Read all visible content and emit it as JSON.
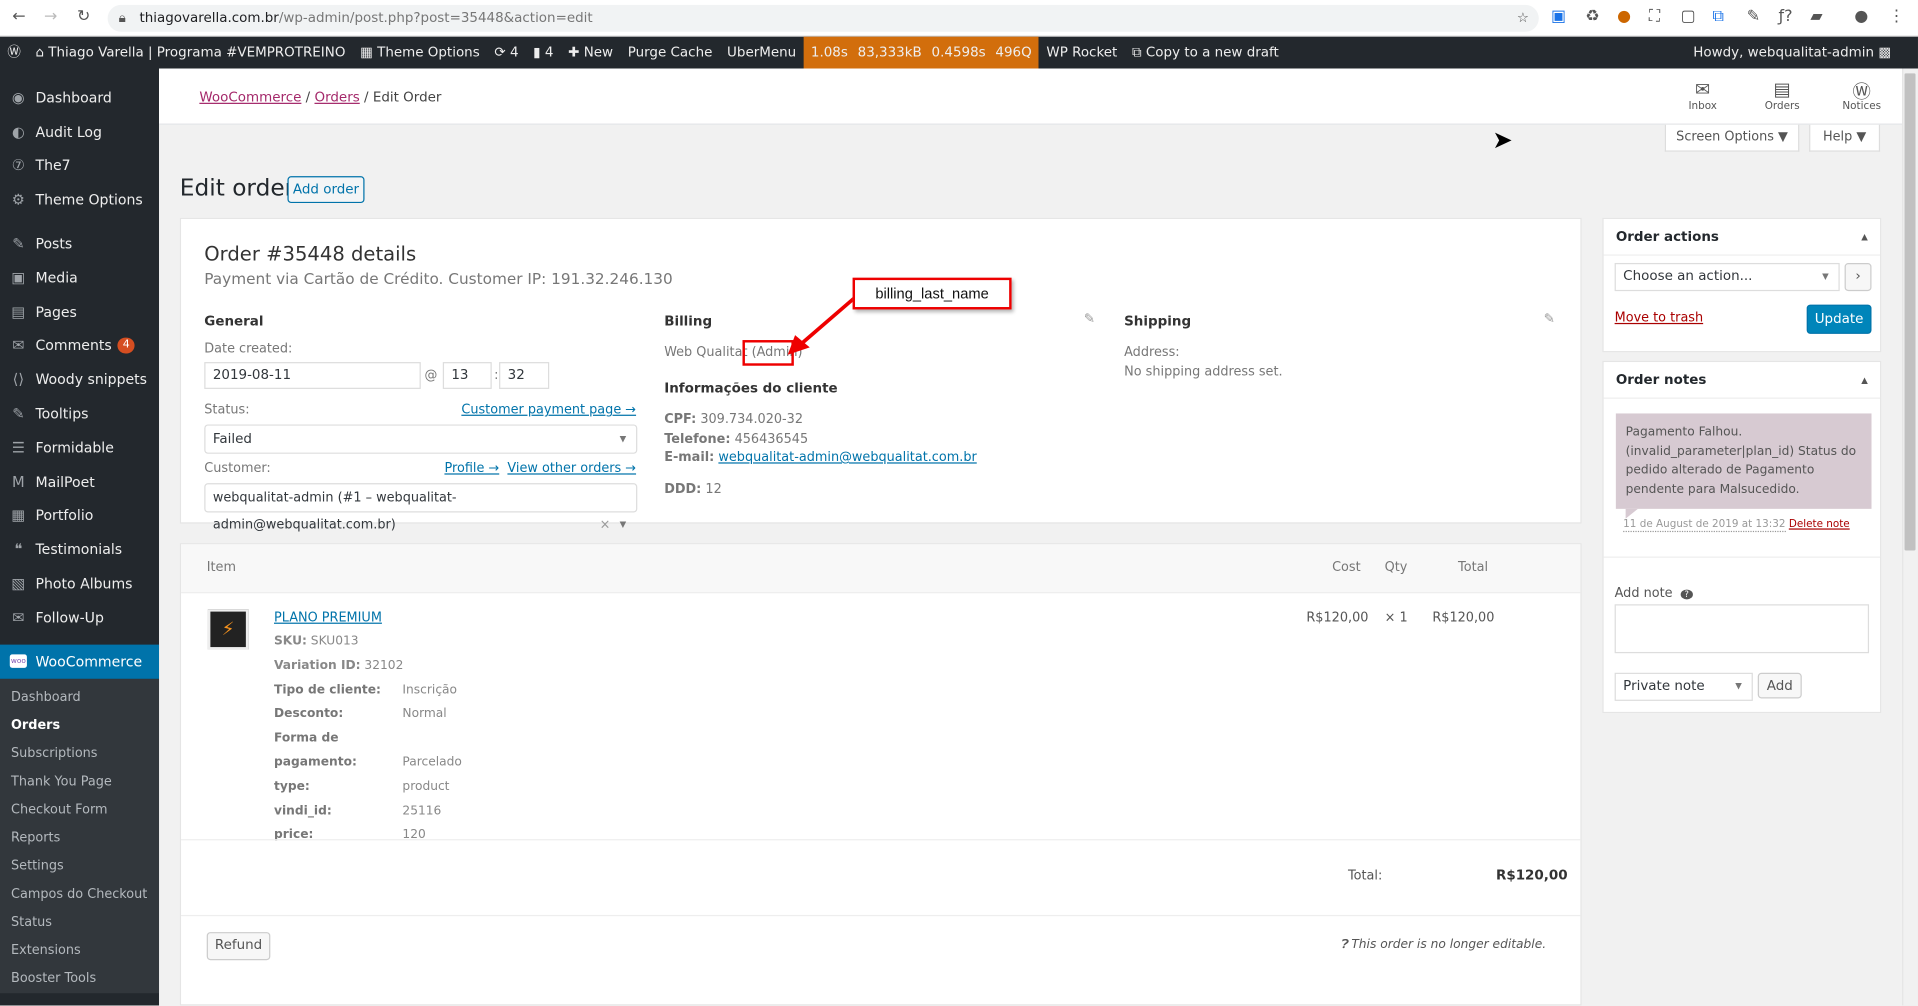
{
  "browser": {
    "url_host": "thiagovarella.com.br",
    "url_path": "/wp-admin/post.php?post=35448&action=edit"
  },
  "adminbar": {
    "site": "Thiago Varella | Programa #VEMPROTREINO",
    "theme_options": "Theme Options",
    "updates": "4",
    "comments": "4",
    "new": "New",
    "purge": "Purge Cache",
    "ubermenu": "UberMenu",
    "perf": [
      "1.08s",
      "83,333kB",
      "0.4598s",
      "496Q"
    ],
    "wprocket": "WP Rocket",
    "copy": "Copy to a new draft",
    "howdy": "Howdy, webqualitat-admin"
  },
  "sidebar": {
    "items": [
      {
        "label": "Dashboard",
        "icon": "◉"
      },
      {
        "label": "Audit Log",
        "icon": "◐"
      },
      {
        "label": "The7",
        "icon": "⑦"
      },
      {
        "label": "Theme Options",
        "icon": "⚙"
      },
      {
        "label": "Posts",
        "icon": "✎"
      },
      {
        "label": "Media",
        "icon": "▣"
      },
      {
        "label": "Pages",
        "icon": "▤"
      },
      {
        "label": "Comments",
        "icon": "✉",
        "badge": "4"
      },
      {
        "label": "Woody snippets",
        "icon": "⟨⟩"
      },
      {
        "label": "Tooltips",
        "icon": "✎"
      },
      {
        "label": "Formidable",
        "icon": "☰"
      },
      {
        "label": "MailPoet",
        "icon": "M"
      },
      {
        "label": "Portfolio",
        "icon": "▦"
      },
      {
        "label": "Testimonials",
        "icon": "❝"
      },
      {
        "label": "Photo Albums",
        "icon": "▧"
      },
      {
        "label": "Follow-Up",
        "icon": "✉"
      }
    ],
    "woo": "WooCommerce",
    "woo_icon": "woo",
    "sub": [
      "Dashboard",
      "Orders",
      "Subscriptions",
      "Thank You Page",
      "Checkout Form",
      "Reports",
      "Settings",
      "Campos do Checkout",
      "Status",
      "Extensions",
      "Booster Tools"
    ]
  },
  "breadcrumb": {
    "root": "WooCommerce",
    "orders": "Orders",
    "current": "Edit Order"
  },
  "toolbar": {
    "inbox": "Inbox",
    "orders": "Orders",
    "notices": "Notices",
    "screen_options": "Screen Options ▼",
    "help": "Help ▼"
  },
  "page": {
    "title": "Edit order",
    "add": "Add order"
  },
  "order": {
    "title": "Order #35448 details",
    "subtitle": "Payment via Cartão de Crédito. Customer IP: 191.32.246.130",
    "general": "General",
    "date_label": "Date created:",
    "date": "2019-08-11",
    "at": "@",
    "hour": "13",
    "colon": ":",
    "minute": "32",
    "status_label": "Status:",
    "payment_page": "Customer payment page →",
    "status": "Failed",
    "customer_label": "Customer:",
    "profile": "Profile →",
    "other_orders": "View other orders →",
    "customer": "webqualitat-admin (#1 – webqualitat-admin@webqualitat.com.br)",
    "clear": "×",
    "billing": "Billing",
    "billing_name": "Web Qualitat",
    "billing_admin": "(Admin)",
    "info": "Informações do cliente",
    "cpf_k": "CPF:",
    "cpf": "309.734.020-32",
    "tel_k": "Telefone:",
    "tel": "456436545",
    "email_k": "E-mail:",
    "email": "webqualitat-admin@webqualitat.com.br",
    "ddd_k": "DDD:",
    "ddd": "12",
    "shipping": "Shipping",
    "address_k": "Address:",
    "no_ship": "No shipping address set."
  },
  "annotation": "billing_last_name",
  "items": {
    "headers": {
      "item": "Item",
      "cost": "Cost",
      "qty": "Qty",
      "total": "Total"
    },
    "name": "PLANO PREMIUM",
    "sku_k": "SKU:",
    "sku": "SKU013",
    "var_k": "Variation ID:",
    "var": "32102",
    "meta": [
      {
        "k": "Tipo de cliente:",
        "v": "Inscrição"
      },
      {
        "k": "Desconto:",
        "v": "Normal"
      },
      {
        "k": "Forma de pagamento:",
        "v": "Parcelado"
      },
      {
        "k": "type:",
        "v": "product"
      },
      {
        "k": "vindi_id:",
        "v": "25116"
      },
      {
        "k": "price:",
        "v": "120"
      }
    ],
    "cost": "R$120,00",
    "qty": "× 1",
    "total": "R$120,00",
    "thumb_text": "PLANO PREMIUM",
    "total_label": "Total:",
    "grand_total": "R$120,00",
    "refund": "Refund",
    "not_editable": "This order is no longer editable."
  },
  "actions": {
    "title": "Order actions",
    "choose": "Choose an action...",
    "go": "›",
    "trash": "Move to trash",
    "update": "Update"
  },
  "notes": {
    "title": "Order notes",
    "note": "Pagamento Falhou. (invalid_parameter|plan_id) Status do pedido alterado de Pagamento pendente para Malsucedido.",
    "date": "11 de August de 2019 at 13:32",
    "delete": "Delete note",
    "add_label": "Add note",
    "help": "?",
    "type": "Private note",
    "add": "Add"
  }
}
